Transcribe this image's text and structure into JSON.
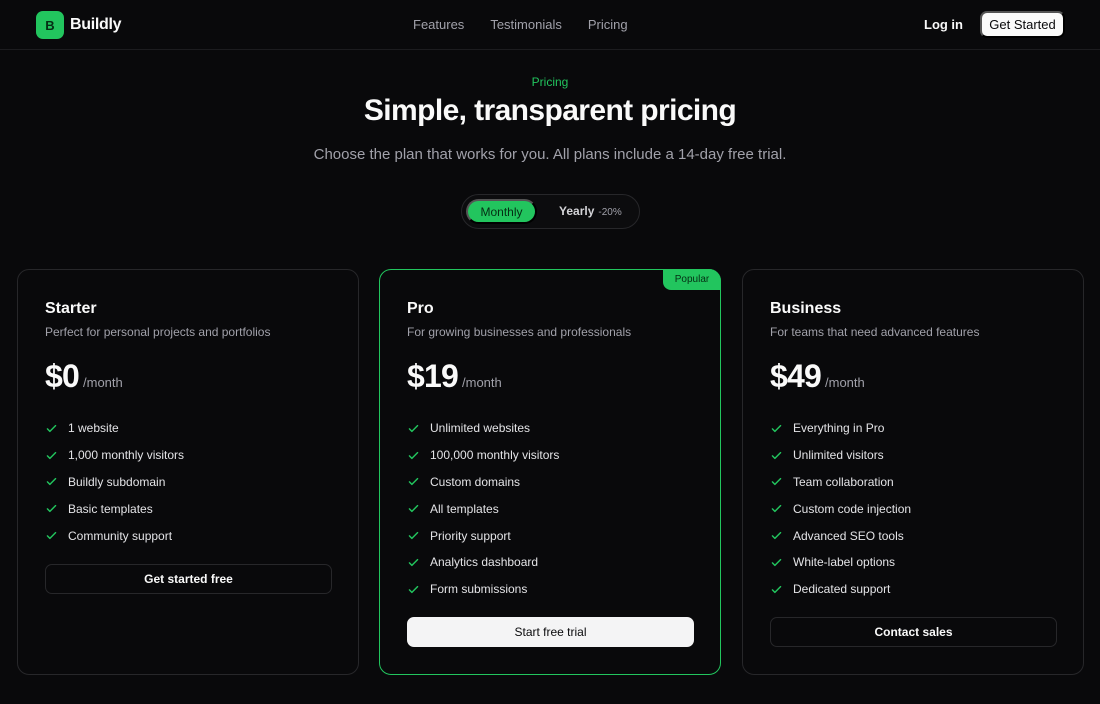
{
  "header": {
    "logo_letter": "B",
    "brand": "Buildly",
    "nav": [
      "Features",
      "Testimonials",
      "Pricing"
    ],
    "login": "Log in",
    "cta": "Get Started"
  },
  "hero": {
    "eyebrow": "Pricing",
    "title": "Simple, transparent pricing",
    "subtitle": "Choose the plan that works for you. All plans include a 14-day free trial."
  },
  "billing_toggle": {
    "monthly": "Monthly",
    "yearly": "Yearly",
    "yearly_discount": "-20%",
    "selected": "Monthly"
  },
  "plans": [
    {
      "name": "Starter",
      "description": "Perfect for personal projects and portfolios",
      "price": "$0",
      "period": "/month",
      "features": [
        "1 website",
        "1,000 monthly visitors",
        "Buildly subdomain",
        "Basic templates",
        "Community support"
      ],
      "button": "Get started free"
    },
    {
      "name": "Pro",
      "badge": "Popular",
      "description": "For growing businesses and professionals",
      "price": "$19",
      "period": "/month",
      "features": [
        "Unlimited websites",
        "100,000 monthly visitors",
        "Custom domains",
        "All templates",
        "Priority support",
        "Analytics dashboard",
        "Form submissions"
      ],
      "button": "Start free trial"
    },
    {
      "name": "Business",
      "description": "For teams that need advanced features",
      "price": "$49",
      "period": "/month",
      "features": [
        "Everything in Pro",
        "Unlimited visitors",
        "Team collaboration",
        "Custom code injection",
        "Advanced SEO tools",
        "White-label options",
        "Dedicated support"
      ],
      "button": "Contact sales"
    }
  ],
  "icons": {
    "feature": "check-icon"
  },
  "colors": {
    "accent": "#22c55e",
    "background": "#09090b",
    "border": "#27272a"
  }
}
